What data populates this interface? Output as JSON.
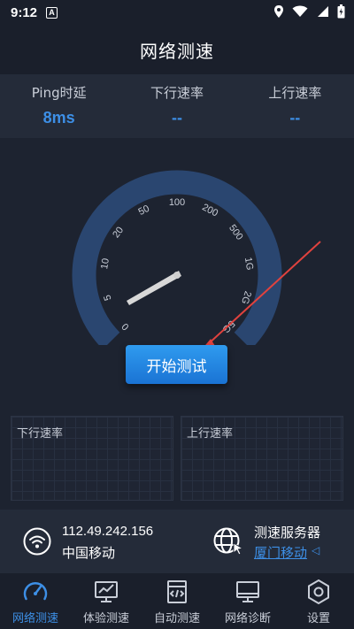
{
  "status_bar": {
    "time": "9:12",
    "notif_letter": "A"
  },
  "header": {
    "title": "网络测速"
  },
  "metrics": [
    {
      "label": "Ping时延",
      "value": "8ms"
    },
    {
      "label": "下行速率",
      "value": "--"
    },
    {
      "label": "上行速率",
      "value": "--"
    }
  ],
  "gauge": {
    "ticks": [
      "0",
      "5",
      "10",
      "20",
      "50",
      "100",
      "200",
      "500",
      "1G",
      "2G",
      "5G"
    ],
    "arc_color": "#2a4670",
    "needle_at_tick": "0"
  },
  "start_button": {
    "label": "开始测试"
  },
  "charts": {
    "download_label": "下行速率",
    "upload_label": "上行速率"
  },
  "network": {
    "ip": "112.49.242.156",
    "carrier": "中国移动"
  },
  "server": {
    "label": "测速服务器",
    "name": "厦门移动"
  },
  "nav": [
    {
      "label": "网络测速",
      "icon": "speedometer-icon",
      "active": true
    },
    {
      "label": "体验测速",
      "icon": "monitor-chart-icon",
      "active": false
    },
    {
      "label": "自动测速",
      "icon": "code-file-icon",
      "active": false
    },
    {
      "label": "网络诊断",
      "icon": "desktop-icon",
      "active": false
    },
    {
      "label": "设置",
      "icon": "settings-hexagon-icon",
      "active": false
    }
  ],
  "colors": {
    "accent": "#3d8fe6",
    "background": "#1d2330",
    "annotation_arrow": "#e0423e"
  }
}
